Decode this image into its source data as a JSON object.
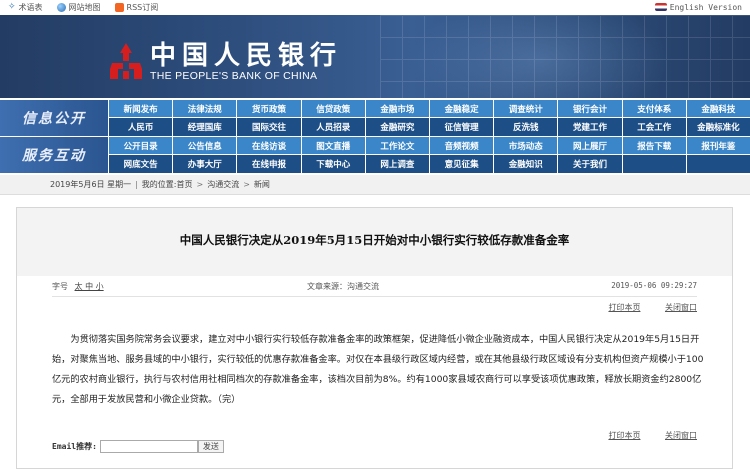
{
  "topbar": {
    "glossary": "术语表",
    "sitemap": "网站地图",
    "rss": "RSS订阅",
    "english": "English Version"
  },
  "banner": {
    "name_cn": "中国人民银行",
    "name_en": "THE PEOPLE'S BANK OF CHINA",
    "logo_color": "#d71e1e"
  },
  "nav": {
    "section1_title": "信息公开",
    "section2_title": "服务互动",
    "section1_items": [
      "新闻发布",
      "法律法规",
      "货币政策",
      "信贷政策",
      "金融市场",
      "金融稳定",
      "调查统计",
      "银行会计",
      "支付体系",
      "金融科技",
      "人民币",
      "经理国库",
      "国际交往",
      "人员招录",
      "金融研究",
      "征信管理",
      "反洗钱",
      "党建工作",
      "工会工作",
      "金融标准化"
    ],
    "section2_items": [
      "公开目录",
      "公告信息",
      "在线访谈",
      "图文直播",
      "工作论文",
      "音频视频",
      "市场动态",
      "网上展厅",
      "报告下载",
      "报刊年鉴",
      "网底文告",
      "办事大厅",
      "在线申报",
      "下载中心",
      "网上调查",
      "意见征集",
      "金融知识",
      "关于我们",
      "",
      ""
    ]
  },
  "breadcrumb": {
    "date": "2019年5月6日 星期一",
    "location_label": "我的位置:",
    "home": "首页",
    "section": "沟通交流",
    "page": "新闻"
  },
  "article": {
    "title": "中国人民银行决定从2019年5月15日开始对中小银行实行较低存款准备金率",
    "font_size_label": "字号",
    "font_sizes": "太 中 小",
    "source": "文章来源：沟通交流",
    "datetime": "2019-05-06 09:29:27",
    "print_link": "打印本页",
    "close_link": "关闭窗口",
    "body": "为贯彻落实国务院常务会议要求，建立对中小银行实行较低存款准备金率的政策框架，促进降低小微企业融资成本，中国人民银行决定从2019年5月15日开始，对聚焦当地、服务县域的中小银行，实行较低的优惠存款准备金率。对仅在本县级行政区域内经营，或在其他县级行政区域设有分支机构但资产规模小于100亿元的农村商业银行，执行与农村信用社相同档次的存款准备金率，该档次目前为8%。约有1000家县域农商行可以享受该项优惠政策，释放长期资金约2800亿元，全部用于发放民营和小微企业贷款。（完）",
    "email_label": "Email推荐:",
    "email_value": "",
    "send_label": "发送"
  }
}
